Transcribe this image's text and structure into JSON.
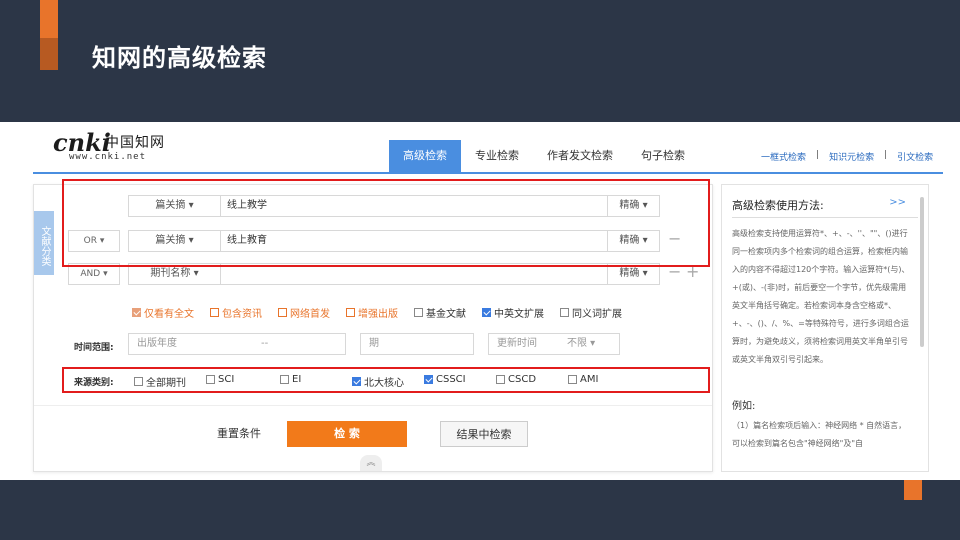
{
  "slide": {
    "title": "知网的高级检索"
  },
  "logo": {
    "brand": "cnki",
    "cn_name": "中国知网",
    "url": "www.cnki.net"
  },
  "tabs": [
    {
      "label": "高级检索",
      "active": true
    },
    {
      "label": "专业检索",
      "active": false
    },
    {
      "label": "作者发文检索",
      "active": false
    },
    {
      "label": "句子检索",
      "active": false
    }
  ],
  "top_links": [
    "一框式检索",
    "知识元检索",
    "引文检索"
  ],
  "side_tag": "文献分类",
  "rows": [
    {
      "logic": "",
      "field": "篇关摘",
      "value": "线上教学",
      "mode": "精确"
    },
    {
      "logic": "OR",
      "field": "篇关摘",
      "value": "线上教育",
      "mode": "精确"
    },
    {
      "logic": "AND",
      "field": "期刊名称",
      "value": "",
      "mode": "精确"
    }
  ],
  "options": [
    {
      "label": "仅看有全文",
      "checked": true,
      "color": "#e8742b"
    },
    {
      "label": "包含资讯",
      "checked": false,
      "color": "#e8742b"
    },
    {
      "label": "网络首发",
      "checked": false,
      "color": "#e8742b"
    },
    {
      "label": "增强出版",
      "checked": false,
      "color": "#e8742b"
    },
    {
      "label": "基金文献",
      "checked": false,
      "color": "#333333"
    },
    {
      "label": "中英文扩展",
      "checked": true,
      "color": "#333333"
    },
    {
      "label": "同义词扩展",
      "checked": false,
      "color": "#333333"
    }
  ],
  "time": {
    "label": "时间范围:",
    "pub_year": "出版年度",
    "dash": "--",
    "period": "期",
    "update": "更新时间",
    "update_value": "不限"
  },
  "source": {
    "label": "来源类别:",
    "items": [
      {
        "label": "全部期刊",
        "checked": false
      },
      {
        "label": "SCI",
        "checked": false
      },
      {
        "label": "EI",
        "checked": false
      },
      {
        "label": "北大核心",
        "checked": true
      },
      {
        "label": "CSSCI",
        "checked": true
      },
      {
        "label": "CSCD",
        "checked": false
      },
      {
        "label": "AMI",
        "checked": false
      }
    ]
  },
  "buttons": {
    "reset": "重置条件",
    "search": "检 索",
    "within": "结果中检索"
  },
  "help": {
    "title": "高级检索使用方法:",
    "more": ">>",
    "body": "高级检索支持使用运算符*、+、-、''、\"\"、()进行同一检索项内多个检索词的组合运算，检索框内输入的内容不得超过120个字符。输入运算符*(与)、+(或)、-(非)时，前后要空一个字节，优先级需用英文半角括号确定。若检索词本身含空格或*、+、-、()、/、%、=等特殊符号，进行多词组合运算时，为避免歧义，须将检索词用英文半角单引号或英文半角双引号引起来。",
    "example_title": "例如:",
    "example_body": "（1）篇名检索项后输入：神经网络 * 自然语言，可以检索到篇名包含\"神经网络\"及\"自"
  },
  "colors": {
    "accent": "#e8742b",
    "band": "#2c3647",
    "tab_active": "#4a8ee0",
    "frame": "#e21c1c"
  }
}
